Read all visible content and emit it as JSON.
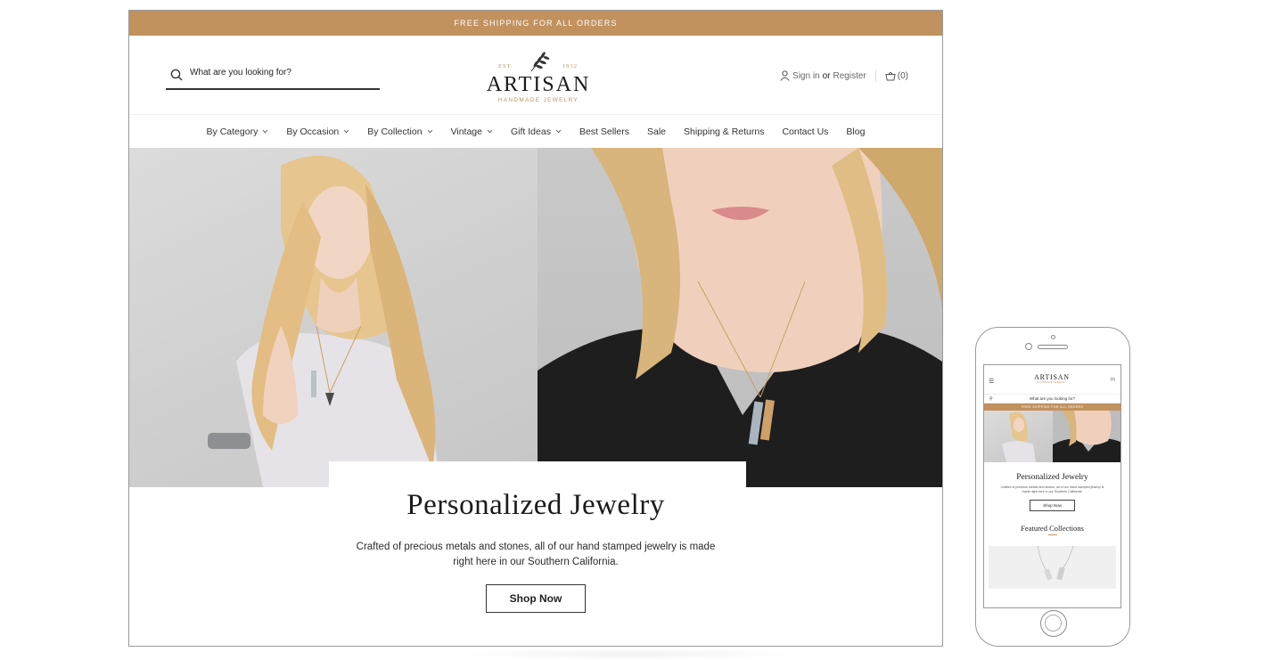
{
  "promo": {
    "text": "FREE SHIPPING FOR ALL ORDERS"
  },
  "search": {
    "placeholder": "What are you looking for?"
  },
  "logo": {
    "est": "EST.",
    "year": "1932",
    "name": "ARTISAN",
    "tagline": "HANDMADE JEWELRY"
  },
  "account": {
    "sign_in": "Sign in",
    "or": "or",
    "register": "Register",
    "cart_count": "(0)"
  },
  "nav": [
    {
      "label": "By Category",
      "dropdown": true
    },
    {
      "label": "By Occasion",
      "dropdown": true
    },
    {
      "label": "By Collection",
      "dropdown": true
    },
    {
      "label": "Vintage",
      "dropdown": true
    },
    {
      "label": "Gift Ideas",
      "dropdown": true
    },
    {
      "label": "Best Sellers",
      "dropdown": false
    },
    {
      "label": "Sale",
      "dropdown": false
    },
    {
      "label": "Shipping & Returns",
      "dropdown": false
    },
    {
      "label": "Contact Us",
      "dropdown": false
    },
    {
      "label": "Blog",
      "dropdown": false
    }
  ],
  "hero": {
    "title": "Personalized Jewelry",
    "description": "Crafted of precious metals and stones, all of our hand stamped jewelry is made right here in our Southern California.",
    "button": "Shop Now"
  },
  "mobile": {
    "logo": "ARTISAN",
    "logo_sub": "HANDMADE JEWELRY",
    "cart": "(0)",
    "search_placeholder": "What are you looking for?",
    "promo": "FREE SHIPPING FOR ALL ORDERS",
    "title": "Personalized Jewelry",
    "description": "Crafted of precious metals and stones, all of our hand stamped jewelry is made right here in our Southern California.",
    "button": "Shop Now",
    "featured_title": "Featured Collections"
  },
  "colors": {
    "accent": "#c1915e",
    "text": "#2b2b2b"
  }
}
